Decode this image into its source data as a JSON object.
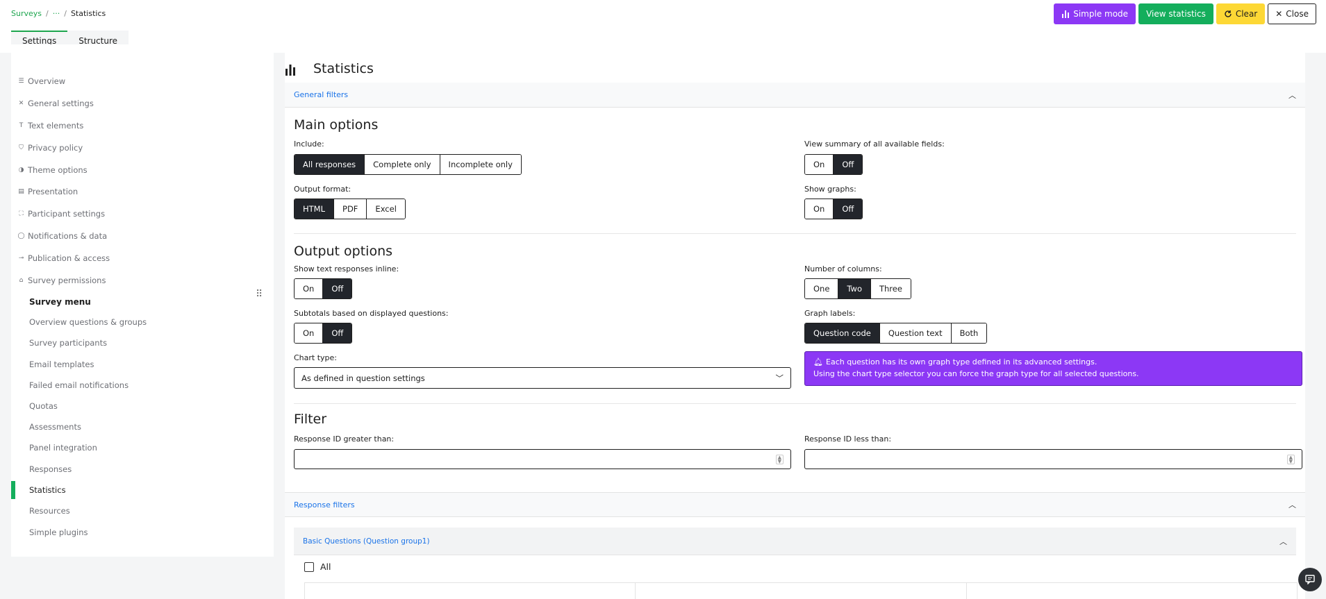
{
  "breadcrumb": {
    "root": "Surveys",
    "ellipsis": "···",
    "current": "Statistics"
  },
  "tabs": [
    {
      "label": "Settings"
    },
    {
      "label": "Structure"
    }
  ],
  "actions": {
    "simple_mode": "Simple mode",
    "view_statistics": "View statistics",
    "clear": "Clear",
    "close": "Close"
  },
  "sidebar": {
    "settings_items": [
      {
        "label": "Overview",
        "icon": "list-icon"
      },
      {
        "label": "General settings",
        "icon": "tools-icon"
      },
      {
        "label": "Text elements",
        "icon": "text-icon"
      },
      {
        "label": "Privacy policy",
        "icon": "shield-icon"
      },
      {
        "label": "Theme options",
        "icon": "palette-icon"
      },
      {
        "label": "Presentation",
        "icon": "screen-icon"
      },
      {
        "label": "Participant settings",
        "icon": "users-icon"
      },
      {
        "label": "Notifications & data",
        "icon": "bell-icon"
      },
      {
        "label": "Publication & access",
        "icon": "key-icon"
      },
      {
        "label": "Survey permissions",
        "icon": "lock-icon"
      }
    ],
    "menu_heading": "Survey menu",
    "menu_items": [
      {
        "label": "Overview questions & groups"
      },
      {
        "label": "Survey participants"
      },
      {
        "label": "Email templates"
      },
      {
        "label": "Failed email notifications"
      },
      {
        "label": "Quotas"
      },
      {
        "label": "Assessments"
      },
      {
        "label": "Panel integration"
      },
      {
        "label": "Responses"
      },
      {
        "label": "Statistics"
      },
      {
        "label": "Resources"
      },
      {
        "label": "Simple plugins"
      }
    ],
    "active_menu_item": "Statistics"
  },
  "main": {
    "title": "Statistics",
    "general_filters_label": "General filters",
    "main_options": {
      "title": "Main options",
      "include": {
        "label": "Include:",
        "options": [
          "All responses",
          "Complete only",
          "Incomplete only"
        ],
        "selected": "All responses"
      },
      "output_format": {
        "label": "Output format:",
        "options": [
          "HTML",
          "PDF",
          "Excel"
        ],
        "selected": "HTML"
      },
      "view_summary": {
        "label": "View summary of all available fields:",
        "options": [
          "On",
          "Off"
        ],
        "selected": "Off"
      },
      "show_graphs": {
        "label": "Show graphs:",
        "options": [
          "On",
          "Off"
        ],
        "selected": "Off"
      }
    },
    "output_options": {
      "title": "Output options",
      "show_text_inline": {
        "label": "Show text responses inline:",
        "options": [
          "On",
          "Off"
        ],
        "selected": "Off"
      },
      "subtotals": {
        "label": "Subtotals based on displayed questions:",
        "options": [
          "On",
          "Off"
        ],
        "selected": "Off"
      },
      "chart_type": {
        "label": "Chart type:",
        "value": "As defined in question settings"
      },
      "num_columns": {
        "label": "Number of columns:",
        "options": [
          "One",
          "Two",
          "Three"
        ],
        "selected": "Two"
      },
      "graph_labels": {
        "label": "Graph labels:",
        "options": [
          "Question code",
          "Question text",
          "Both"
        ],
        "selected": "Question code"
      },
      "alert_line1": "Each question has its own graph type defined in its advanced settings.",
      "alert_line2": "Using the chart type selector you can force the graph type for all selected questions."
    },
    "filter": {
      "title": "Filter",
      "greater_label": "Response ID greater than:",
      "greater_value": "",
      "less_label": "Response ID less than:",
      "less_value": ""
    },
    "response_filters_label": "Response filters",
    "group_label": "Basic Questions (Question group1)",
    "all_checkbox_label": "All"
  },
  "colors": {
    "accent_green": "#14ae5c",
    "purple": "#8c38f5",
    "yellow": "#fdd835",
    "selected_dark": "#22252b"
  }
}
